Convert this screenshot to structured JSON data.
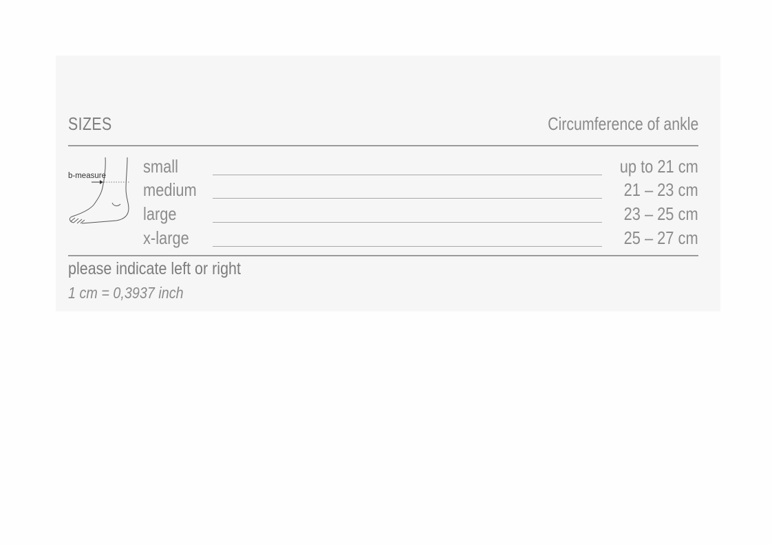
{
  "sizes_table": {
    "title": "SIZES",
    "column_header": "Circumference of ankle",
    "rows": [
      {
        "size": "small",
        "range": "up to 21 cm"
      },
      {
        "size": "medium",
        "range": "21 – 23 cm"
      },
      {
        "size": "large",
        "range": "23 – 25 cm"
      },
      {
        "size": "x-large",
        "range": "25 – 27 cm"
      }
    ],
    "illustration": {
      "icon": "ankle-foot-diagram-icon",
      "label": "b-measure"
    },
    "note": "please indicate left or right",
    "conversion": "1 cm = 0,3937 inch"
  },
  "colors": {
    "panel_background": "#f6f6f6",
    "text": "#8c8c8c",
    "rule": "#9a9a9a"
  }
}
